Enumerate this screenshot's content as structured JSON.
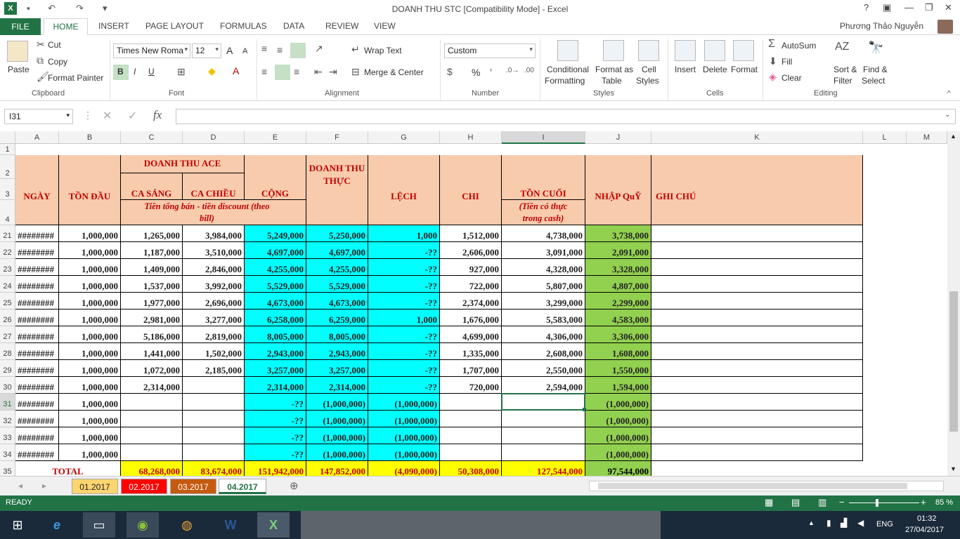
{
  "window": {
    "title": "DOANH THU STC  [Compatibility Mode] - Excel",
    "help": "?",
    "minimize": "—",
    "restore": "❐",
    "close": "✕"
  },
  "qat": {
    "undo": "↶",
    "redo": "↷",
    "more": "▾",
    "save": "▪"
  },
  "tabs": [
    "FILE",
    "HOME",
    "INSERT",
    "PAGE LAYOUT",
    "FORMULAS",
    "DATA",
    "REVIEW",
    "VIEW"
  ],
  "user": "Phương Thảo Nguyễn",
  "ribbon": {
    "clipboard": {
      "paste": "Paste",
      "cut": "Cut",
      "copy": "Copy",
      "format_painter": "Format Painter",
      "label": "Clipboard"
    },
    "font": {
      "name": "Times New Roma",
      "size": "12",
      "bold": "B",
      "italic": "I",
      "underline": "U",
      "grow": "A",
      "shrink": "A",
      "label": "Font"
    },
    "alignment": {
      "wrap": "Wrap Text",
      "merge": "Merge & Center",
      "label": "Alignment"
    },
    "number": {
      "format": "Custom",
      "percent": "%",
      "comma": "’",
      "label": "Number"
    },
    "styles": {
      "conditional": "Conditional",
      "conditional2": "Formatting",
      "format_as": "Format as",
      "format_as2": "Table",
      "cell": "Cell",
      "cell2": "Styles",
      "label": "Styles"
    },
    "cells": {
      "insert": "Insert",
      "delete": "Delete",
      "format": "Format",
      "label": "Cells"
    },
    "editing": {
      "autosum": "AutoSum",
      "fill": "Fill",
      "clear": "Clear",
      "sort": "Sort &",
      "sort2": "Filter",
      "find": "Find &",
      "find2": "Select",
      "label": "Editing"
    }
  },
  "namebox": "I31",
  "fx": "fx",
  "columns": [
    "A",
    "B",
    "C",
    "D",
    "E",
    "F",
    "G",
    "H",
    "I",
    "J",
    "K",
    "L",
    "M"
  ],
  "headers": {
    "ngay": "NGÀY",
    "ton_dau": "TỒN ĐẦU",
    "doanh_thu_ace": "DOANH THU ACE",
    "ca_sang": "CA SÁNG",
    "ca_chieu": "CA CHIỀU",
    "cong": "CỘNG",
    "doanh_thu_thuc": "DOANH THU THỰC",
    "lech": "LỆCH",
    "chi": "CHI",
    "ton_cuoi": "TỒN CUỐI",
    "nhap_quy": "NHẬP QuỸ",
    "ghi_chu": "GHI CHÚ",
    "note1": "Tiền tổng bán - tiền discount (theo bill)",
    "note2": "(Tiền có thực trong cash)"
  },
  "row_numbers_top": [
    "1",
    "2",
    "3",
    "4"
  ],
  "rows": [
    {
      "n": "21",
      "a": "########",
      "b": "1,000,000",
      "c": "1,265,000",
      "d": "3,984,000",
      "e": "5,249,000",
      "f": "5,250,000",
      "g": "1,000",
      "h": "1,512,000",
      "i": "4,738,000",
      "j": "3,738,000"
    },
    {
      "n": "22",
      "a": "########",
      "b": "1,000,000",
      "c": "1,187,000",
      "d": "3,510,000",
      "e": "4,697,000",
      "f": "4,697,000",
      "g": "-??",
      "h": "2,606,000",
      "i": "3,091,000",
      "j": "2,091,000"
    },
    {
      "n": "23",
      "a": "########",
      "b": "1,000,000",
      "c": "1,409,000",
      "d": "2,846,000",
      "e": "4,255,000",
      "f": "4,255,000",
      "g": "-??",
      "h": "927,000",
      "i": "4,328,000",
      "j": "3,328,000"
    },
    {
      "n": "24",
      "a": "########",
      "b": "1,000,000",
      "c": "1,537,000",
      "d": "3,992,000",
      "e": "5,529,000",
      "f": "5,529,000",
      "g": "-??",
      "h": "722,000",
      "i": "5,807,000",
      "j": "4,807,000"
    },
    {
      "n": "25",
      "a": "########",
      "b": "1,000,000",
      "c": "1,977,000",
      "d": "2,696,000",
      "e": "4,673,000",
      "f": "4,673,000",
      "g": "-??",
      "h": "2,374,000",
      "i": "3,299,000",
      "j": "2,299,000"
    },
    {
      "n": "26",
      "a": "########",
      "b": "1,000,000",
      "c": "2,981,000",
      "d": "3,277,000",
      "e": "6,258,000",
      "f": "6,259,000",
      "g": "1,000",
      "h": "1,676,000",
      "i": "5,583,000",
      "j": "4,583,000"
    },
    {
      "n": "27",
      "a": "########",
      "b": "1,000,000",
      "c": "5,186,000",
      "d": "2,819,000",
      "e": "8,005,000",
      "f": "8,005,000",
      "g": "-??",
      "h": "4,699,000",
      "i": "4,306,000",
      "j": "3,306,000"
    },
    {
      "n": "28",
      "a": "########",
      "b": "1,000,000",
      "c": "1,441,000",
      "d": "1,502,000",
      "e": "2,943,000",
      "f": "2,943,000",
      "g": "-??",
      "h": "1,335,000",
      "i": "2,608,000",
      "j": "1,608,000"
    },
    {
      "n": "29",
      "a": "########",
      "b": "1,000,000",
      "c": "1,072,000",
      "d": "2,185,000",
      "e": "3,257,000",
      "f": "3,257,000",
      "g": "-??",
      "h": "1,707,000",
      "i": "2,550,000",
      "j": "1,550,000"
    },
    {
      "n": "30",
      "a": "########",
      "b": "1,000,000",
      "c": "2,314,000",
      "d": "",
      "e": "2,314,000",
      "f": "2,314,000",
      "g": "-??",
      "h": "720,000",
      "i": "2,594,000",
      "j": "1,594,000"
    },
    {
      "n": "31",
      "a": "########",
      "b": "1,000,000",
      "c": "",
      "d": "",
      "e": "-??",
      "f": "(1,000,000)",
      "g": "(1,000,000)",
      "h": "",
      "i": "",
      "j": "(1,000,000)"
    },
    {
      "n": "32",
      "a": "########",
      "b": "1,000,000",
      "c": "",
      "d": "",
      "e": "-??",
      "f": "(1,000,000)",
      "g": "(1,000,000)",
      "h": "",
      "i": "",
      "j": "(1,000,000)"
    },
    {
      "n": "33",
      "a": "########",
      "b": "1,000,000",
      "c": "",
      "d": "",
      "e": "-??",
      "f": "(1,000,000)",
      "g": "(1,000,000)",
      "h": "",
      "i": "",
      "j": "(1,000,000)"
    },
    {
      "n": "34",
      "a": "########",
      "b": "1,000,000",
      "c": "",
      "d": "",
      "e": "-??",
      "f": "(1,000,000)",
      "g": "(1,000,000)",
      "h": "",
      "i": "",
      "j": "(1,000,000)"
    }
  ],
  "total": {
    "n": "35",
    "label": "TOTAL",
    "c": "68,268,000",
    "d": "83,674,000",
    "e": "151,942,000",
    "f": "147,852,000",
    "g": "(4,090,000)",
    "h": "50,308,000",
    "i": "127,544,000",
    "j": "97,544,000"
  },
  "sheets": [
    "01.2017",
    "02.2017",
    "03.2017",
    "04.2017"
  ],
  "active_sheet": "04.2017",
  "status": {
    "ready": "READY",
    "zoom": "85 %",
    "minus": "−",
    "plus": "+"
  },
  "taskbar": {
    "lang": "ENG",
    "time": "01:32",
    "date": "27/04/2017"
  }
}
